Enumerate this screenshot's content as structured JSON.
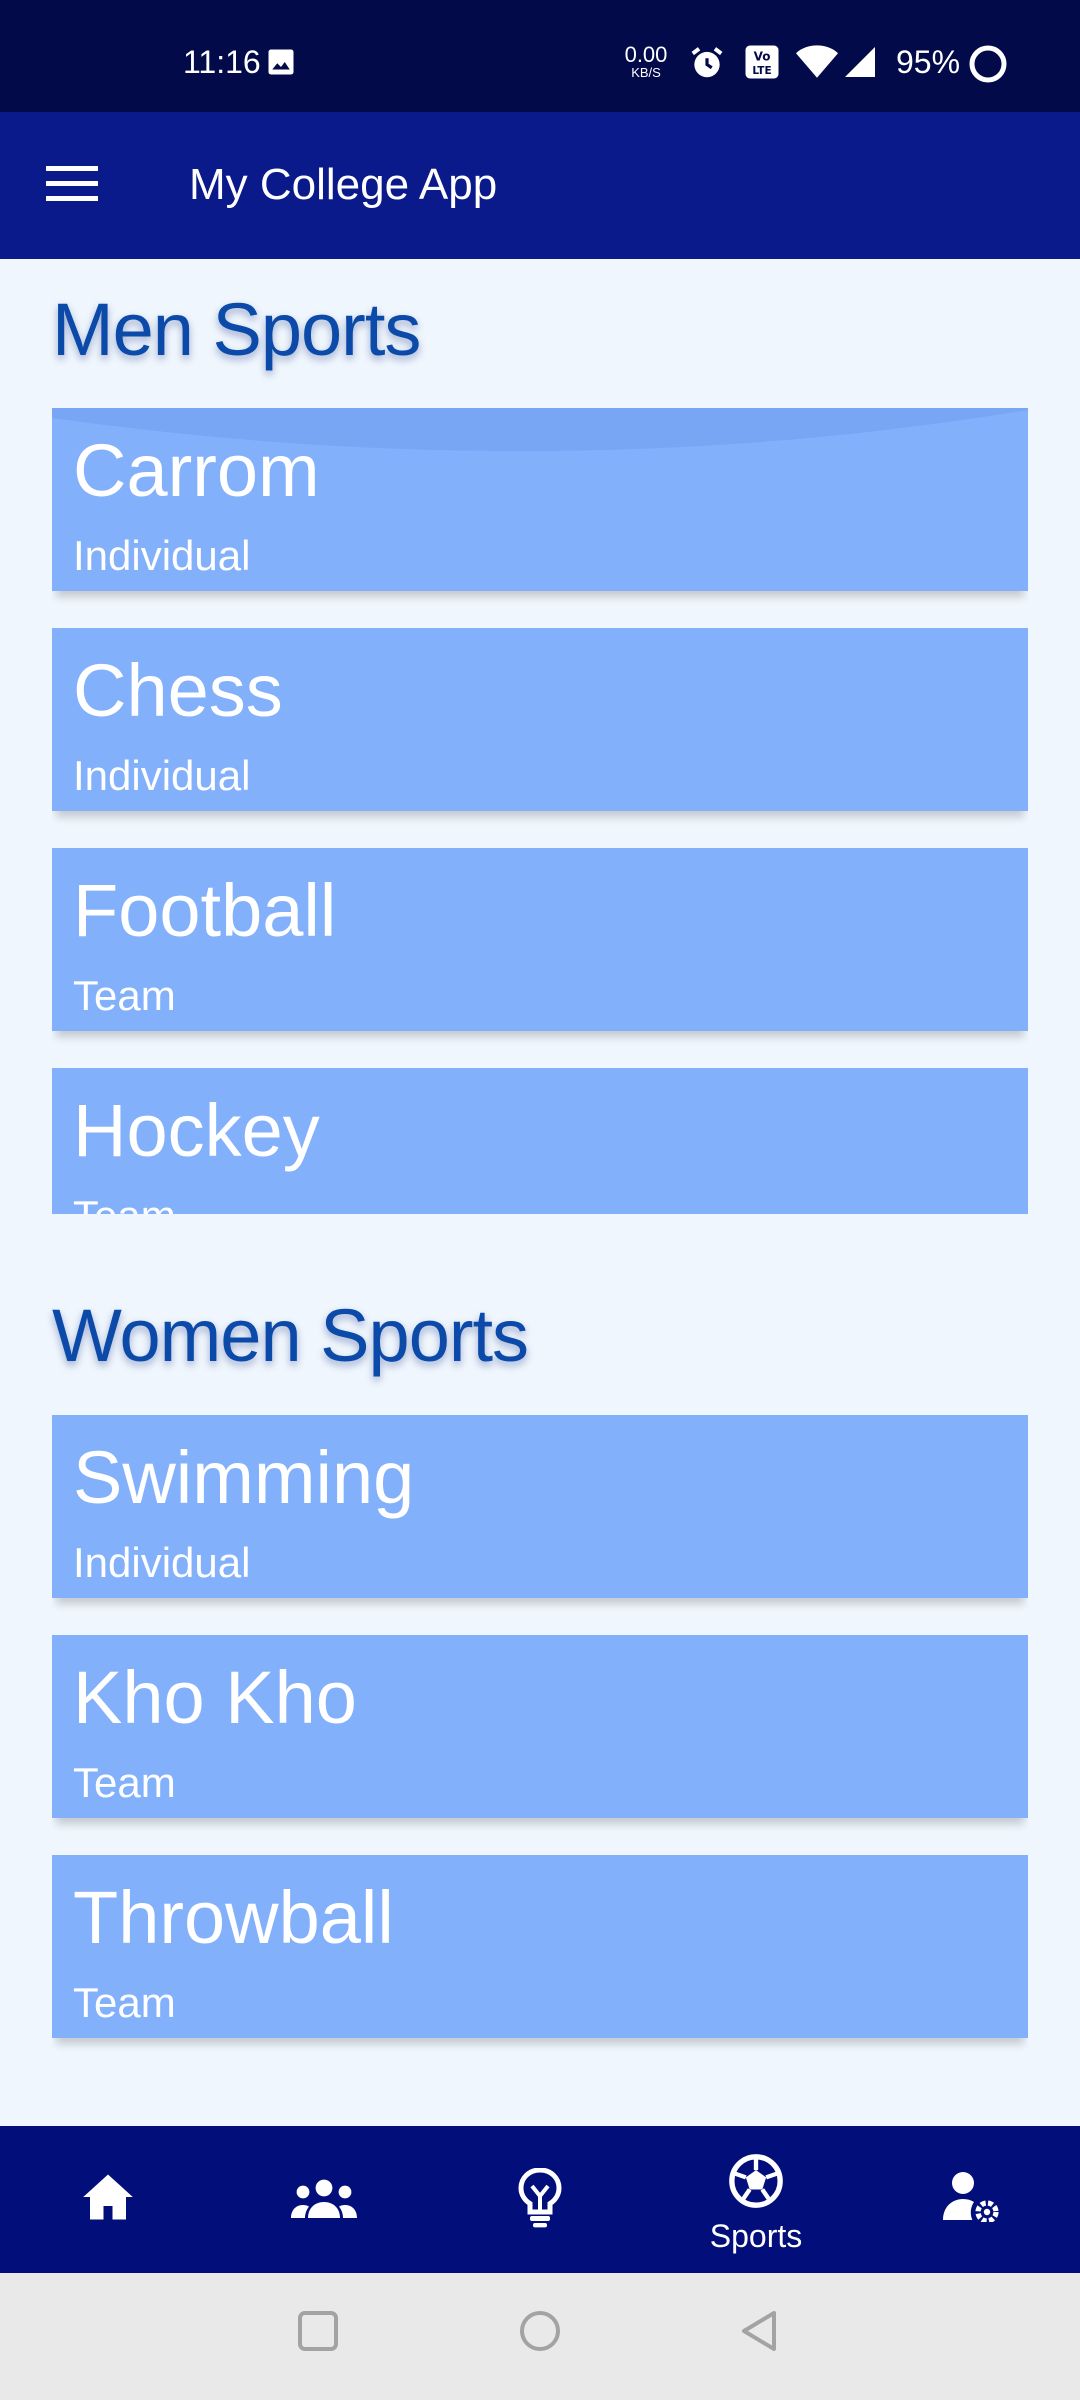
{
  "status_bar": {
    "time": "11:16",
    "net_speed_value": "0.00",
    "net_speed_unit": "KB/S",
    "battery_percent": "95%"
  },
  "app_bar": {
    "title": "My College App"
  },
  "sections": {
    "men": {
      "title": "Men Sports",
      "items": [
        {
          "name": "Carrom",
          "type": "Individual"
        },
        {
          "name": "Chess",
          "type": "Individual"
        },
        {
          "name": "Football",
          "type": "Team"
        },
        {
          "name": "Hockey",
          "type": "Team"
        }
      ]
    },
    "women": {
      "title": "Women Sports",
      "items": [
        {
          "name": "Swimming",
          "type": "Individual"
        },
        {
          "name": "Kho Kho",
          "type": "Team"
        },
        {
          "name": "Throwball",
          "type": "Team"
        }
      ]
    }
  },
  "bottom_nav": {
    "items": [
      {
        "icon": "home-icon",
        "label": ""
      },
      {
        "icon": "group-icon",
        "label": ""
      },
      {
        "icon": "lightbulb-icon",
        "label": ""
      },
      {
        "icon": "soccer-ball-icon",
        "label": "Sports",
        "active": true
      },
      {
        "icon": "user-settings-icon",
        "label": ""
      }
    ]
  },
  "colors": {
    "status_bar": "#020a4a",
    "app_bar": "#0a1a8a",
    "bottom_nav": "#020e7a",
    "card": "#82b0fb",
    "section_title": "#0b4aa8",
    "background": "#eff6fd"
  }
}
